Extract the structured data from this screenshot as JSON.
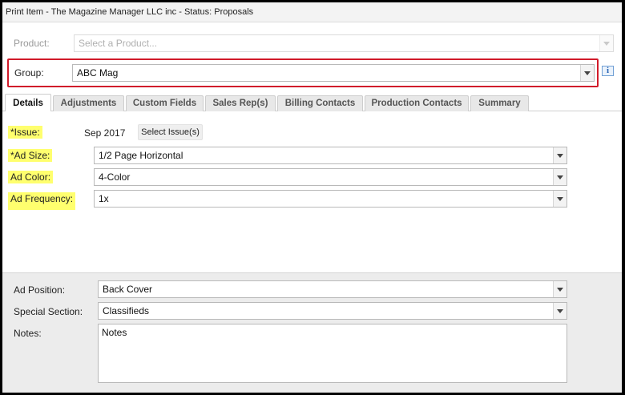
{
  "window": {
    "title": "Print Item - The Magazine Manager LLC inc - Status: Proposals"
  },
  "product": {
    "label": "Product:",
    "placeholder": "Select a Product..."
  },
  "group": {
    "label": "Group:",
    "value": "ABC Mag"
  },
  "tabs": [
    "Details",
    "Adjustments",
    "Custom Fields",
    "Sales Rep(s)",
    "Billing Contacts",
    "Production Contacts",
    "Summary"
  ],
  "details": {
    "issue_label": "*Issue:",
    "issue_value": "Sep 2017",
    "select_issues_button": "Select Issue(s)",
    "ad_size_label": "*Ad Size:",
    "ad_size_value": "1/2 Page Horizontal",
    "ad_color_label": "Ad Color:",
    "ad_color_value": "4-Color",
    "ad_frequency_label": "Ad Frequency:",
    "ad_frequency_value": "1x"
  },
  "lower": {
    "ad_position_label": "Ad Position:",
    "ad_position_value": "Back Cover",
    "special_section_label": "Special Section:",
    "special_section_value": "Classifieds",
    "notes_label": "Notes:",
    "notes_value": "Notes"
  },
  "colors": {
    "highlight": "#ffff6e",
    "red_outline": "#d11b2a"
  },
  "icons": {
    "info": "info-icon",
    "dropdown": "chevron-down-icon"
  }
}
